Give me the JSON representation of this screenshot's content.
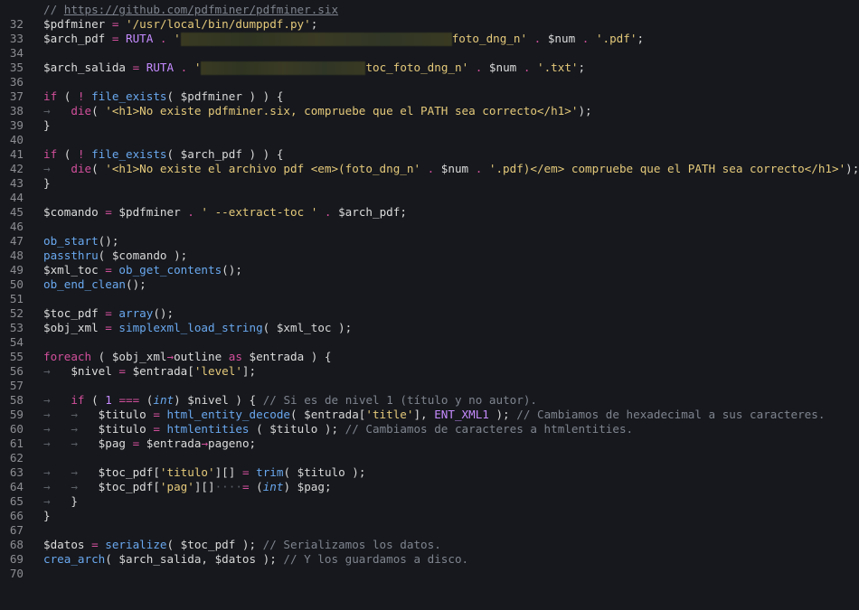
{
  "editor": {
    "line_numbers": [
      "32",
      "33",
      "34",
      "35",
      "36",
      "37",
      "38",
      "39",
      "40",
      "41",
      "42",
      "43",
      "44",
      "45",
      "46",
      "47",
      "48",
      "49",
      "50",
      "51",
      "52",
      "53",
      "54",
      "55",
      "56",
      "57",
      "58",
      "59",
      "60",
      "61",
      "62",
      "63",
      "64",
      "65",
      "66",
      "67",
      "68",
      "69",
      "70"
    ],
    "code": {
      "l32": {
        "comment": "// ",
        "url": "https://github.com/pdfminer/pdfminer.six"
      },
      "l33": {
        "var": "$pdfminer",
        "op": " = ",
        "str": "'/usr/local/bin/dumppdf.py'",
        "end": ";"
      },
      "l34": {
        "var": "$arch_pdf",
        "op": " = ",
        "const": "RUTA",
        "dot": " . ",
        "str_open": "'",
        "str_tail": "foto_dng_n'",
        "dot2": " . ",
        "num": "$num",
        "dot3": " . ",
        "ext": "'.pdf'",
        "end": ";"
      },
      "l36": {
        "var": "$arch_salida",
        "op": " = ",
        "const": "RUTA",
        "dot": " . ",
        "str_open": "'",
        "str_tail": "toc_foto_dng_n'",
        "dot2": " . ",
        "num": "$num",
        "dot3": " . ",
        "ext": "'.txt'",
        "end": ";"
      },
      "l38": {
        "kw": "if",
        "p1": " ( ",
        "not": "!",
        "sp": " ",
        "fn": "file_exists",
        "args": "( $pdfminer ) ) {"
      },
      "l39": {
        "guide": "→",
        "kw": "die",
        "p1": "( ",
        "str": "'<h1>No existe pdfminer.six, compruebe que el PATH sea correcto</h1>'",
        "end": ");"
      },
      "l40": {
        "text": "}"
      },
      "l42": {
        "kw": "if",
        "p1": " ( ",
        "not": "!",
        "sp": " ",
        "fn": "file_exists",
        "args": "( $arch_pdf ) ) {"
      },
      "l43": {
        "guide": "→",
        "kw": "die",
        "p1": "( ",
        "str1": "'<h1>No existe el archivo pdf <em>(foto_dng_n'",
        "dot": " . ",
        "num": "$num",
        "dot2": " . ",
        "str2": "'.pdf)</em> compruebe que el PATH sea correcto</h1>'",
        "end": ");"
      },
      "l44": {
        "text": "}"
      },
      "l46": {
        "var": "$comando",
        "op": " = ",
        "v2": "$pdfminer",
        "dot": " . ",
        "str": "' --extract-toc '",
        "dot2": " . ",
        "v3": "$arch_pdf",
        "end": ";"
      },
      "l48": {
        "fn": "ob_start",
        "end": "();"
      },
      "l49": {
        "fn": "passthru",
        "args": "( $comando );"
      },
      "l50": {
        "var": "$xml_toc",
        "op": " = ",
        "fn": "ob_get_contents",
        "end": "();"
      },
      "l51": {
        "fn": "ob_end_clean",
        "end": "();"
      },
      "l53": {
        "var": "$toc_pdf",
        "op": " = ",
        "fn": "array",
        "end": "();"
      },
      "l54": {
        "var": "$obj_xml",
        "op": " = ",
        "fn": "simplexml_load_string",
        "args": "( $xml_toc );"
      },
      "l56": {
        "kw": "foreach",
        "p1": " ( ",
        "v1": "$obj_xml",
        "arrow": "→",
        "prop": "outline",
        "as": " as ",
        "v2": "$entrada",
        "end": " ) {"
      },
      "l57": {
        "guide": "→",
        "var": "$nivel",
        "op": " = ",
        "v2": "$entrada[",
        "str": "'level'",
        "end": "];"
      },
      "l59": {
        "guide": "→",
        "kw": "if",
        "p1": " ( ",
        "num": "1",
        "op": " === ",
        "cast_open": "(",
        "cast": "int",
        "cast_close": ")",
        "rest": " $nivel ) { ",
        "comment": "// Si es de nivel 1 (título y no autor)."
      },
      "l60": {
        "guide": "→   →",
        "var": "$titulo",
        "op": " = ",
        "fn": "html_entity_decode",
        "args1": "( $entrada[",
        "str": "'title'",
        "args2": "], ",
        "const": "ENT_XML1",
        "end": " ); ",
        "comment": "// Cambiamos de hexadecimal a sus caracteres."
      },
      "l61": {
        "guide": "→   →",
        "var": "$titulo",
        "op": " = ",
        "fn": "htmlentities",
        "args": " ( $titulo ); ",
        "comment": "// Cambiamos de caracteres a htmlentities."
      },
      "l62": {
        "guide": "→   →",
        "var": "$pag",
        "op": " = ",
        "v2": "$entrada",
        "arrow": "→",
        "prop": "pageno;"
      },
      "l64": {
        "guide": "→   →",
        "var": "$toc_pdf[",
        "str": "'titulo'",
        "rest": "][] ",
        "op": "=",
        "sp": " ",
        "fn": "trim",
        "args": "( $titulo );"
      },
      "l65": {
        "guide": "→   →",
        "var": "$toc_pdf[",
        "str": "'pag'",
        "rest": "][]",
        "dots": "····",
        "op": "=",
        "sp": " ",
        "cast_open": "(",
        "cast": "int",
        "cast_close": ")",
        "end": " $pag;"
      },
      "l66": {
        "guide": "→",
        "text": "}"
      },
      "l67": {
        "text": "}"
      },
      "l69": {
        "var": "$datos",
        "op": " = ",
        "fn": "serialize",
        "args": "( $toc_pdf ); ",
        "comment": "// Serializamos los datos."
      },
      "l70": {
        "fn": "crea_arch",
        "args": "( $arch_salida, $datos ); ",
        "comment": "// Y los guardamos a disco."
      }
    }
  },
  "colors": {
    "background": "#16181d",
    "line_number": "#8b8d92",
    "variable": "#dcdcdc",
    "string": "#e5c97a",
    "keyword": "#d24f9b",
    "function": "#6aa8ef",
    "comment": "#7f848e",
    "constant": "#c68bff"
  }
}
